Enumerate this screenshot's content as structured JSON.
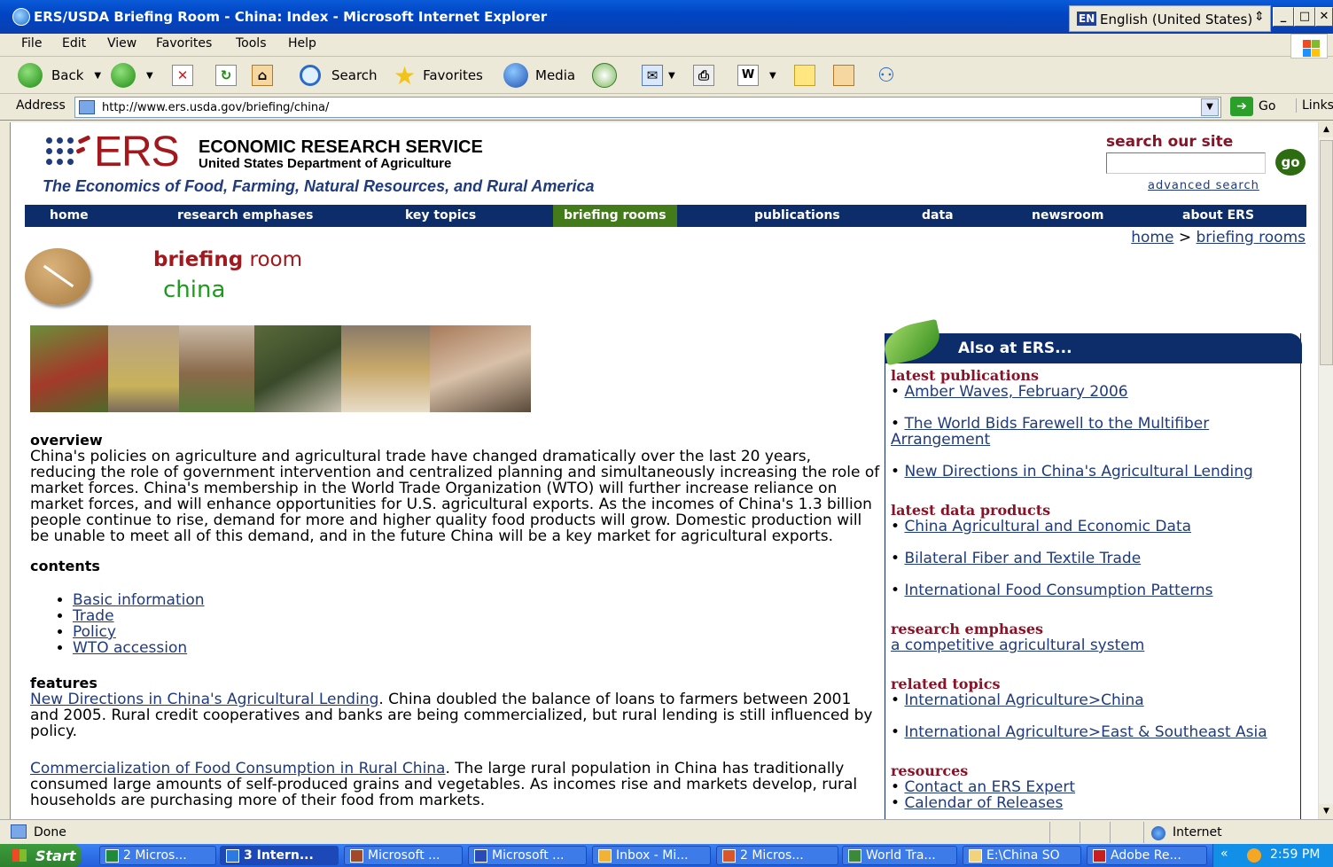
{
  "window": {
    "title": "ERS/USDA Briefing Room - China: Index - Microsoft Internet Explorer",
    "language_badge": "EN",
    "language": "English (United States)",
    "minimize": "_",
    "maximize": "□",
    "close": "✕"
  },
  "menu": [
    "File",
    "Edit",
    "View",
    "Favorites",
    "Tools",
    "Help"
  ],
  "toolbar": {
    "back": "Back",
    "search": "Search",
    "favorites": "Favorites",
    "media": "Media"
  },
  "address": {
    "label": "Address",
    "url": "http://www.ers.usda.gov/briefing/china/",
    "go": "Go",
    "links": "Links"
  },
  "site": {
    "logo_text": "ERS",
    "name": "ECONOMIC RESEARCH SERVICE",
    "dept": "United States Department of Agriculture",
    "tagline": "The Economics of Food, Farming, Natural Resources, and Rural America",
    "search_label": "search our site",
    "search_value": "",
    "search_go": "go",
    "advanced_search": "advanced search"
  },
  "nav": [
    "home",
    "research emphases",
    "key topics",
    "briefing rooms",
    "publications",
    "data",
    "newsroom",
    "about ERS"
  ],
  "nav_active": "briefing rooms",
  "breadcrumb": {
    "home": "home",
    "sep": ">",
    "current": "briefing rooms"
  },
  "briefing": {
    "title_bold": "briefing",
    "title_rest": "room",
    "topic": "china"
  },
  "main": {
    "overview_heading": "overview",
    "overview_text": "China's policies on agriculture and agricultural trade have changed dramatically over the last 20 years, reducing the role of government intervention and centralized planning and simultaneously increasing the role of market forces. China's membership in the World Trade Organization (WTO) will further increase reliance on market forces, and will enhance opportunities for U.S. agricultural exports. As the incomes of China's 1.3 billion people continue to rise, demand for more and higher quality food products will grow. Domestic production will be unable to meet all of this demand, and in the future China will be a key market for agricultural exports.",
    "contents_heading": "contents",
    "contents": [
      "Basic information",
      "Trade",
      "Policy",
      "WTO accession"
    ],
    "features_heading": "features",
    "features": [
      {
        "link": "New Directions in China's Agricultural Lending",
        "text": ". China doubled the balance of loans to farmers between 2001 and 2005. Rural credit cooperatives and banks are being commercialized, but rural lending is still influenced by policy."
      },
      {
        "link": "Commercialization of Food Consumption in Rural China",
        "text": ". The large rural population in China has traditionally consumed large amounts of self-produced grains and vegetables. As incomes rise and markets develop, rural households are purchasing more of their food from markets."
      }
    ]
  },
  "sidebar": {
    "title": "Also at ERS...",
    "sections": [
      {
        "heading": "latest publications",
        "items": [
          "Amber Waves, February 2006",
          "The World Bids Farewell to the Multifiber Arrangement",
          "New Directions in China's Agricultural Lending"
        ]
      },
      {
        "heading": "latest data products",
        "items": [
          "China Agricultural and Economic Data",
          "Bilateral Fiber and Textile Trade",
          "International Food Consumption Patterns"
        ]
      },
      {
        "heading": "research emphases",
        "items": [
          "a competitive agricultural system"
        ]
      },
      {
        "heading": "related topics",
        "items": [
          "International Agriculture>China",
          "International Agriculture>East & Southeast Asia"
        ]
      },
      {
        "heading": "resources",
        "items": [
          "Contact an ERS Expert",
          "Calendar of Releases"
        ]
      }
    ]
  },
  "status": {
    "text": "Done",
    "zone": "Internet"
  },
  "taskbar": {
    "start": "Start",
    "tasks": [
      "2 Micros...",
      "3 Intern...",
      "Microsoft ...",
      "Microsoft ...",
      "Inbox - Mi...",
      "2 Micros...",
      "World Tra...",
      "E:\\China SO",
      "Adobe Re..."
    ],
    "chevron": "«",
    "clock": "2:59 PM"
  }
}
